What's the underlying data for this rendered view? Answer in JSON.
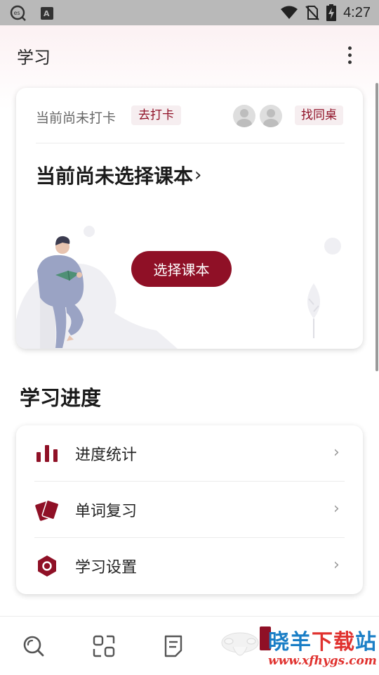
{
  "status_bar": {
    "time": "4:27",
    "left_icons": [
      "es-file-icon",
      "font-app-icon"
    ],
    "right_icons": [
      "wifi-icon",
      "no-sim-icon",
      "battery-charging-icon"
    ]
  },
  "header": {
    "title": "学习",
    "menu_icon": "more-vertical-icon"
  },
  "checkin_card": {
    "status_text": "当前尚未打卡",
    "checkin_button": "去打卡",
    "find_deskmate_button": "找同桌",
    "textbook_title": "当前尚未选择课本",
    "textbook_chevron": "›",
    "select_textbook_button": "选择课本"
  },
  "progress_section": {
    "title": "学习进度",
    "items": [
      {
        "label": "进度统计",
        "icon": "bar-chart-icon",
        "chevron": "›"
      },
      {
        "label": "单词复习",
        "icon": "word-cards-icon",
        "chevron": "›"
      },
      {
        "label": "学习设置",
        "icon": "settings-hexagon-icon",
        "chevron": "›"
      }
    ]
  },
  "tabbar": {
    "tabs": [
      {
        "icon": "search-tab-icon"
      },
      {
        "icon": "scan-tab-icon"
      },
      {
        "icon": "notes-tab-icon"
      },
      {
        "icon": "study-tab-icon"
      }
    ]
  },
  "watermark": {
    "brand_part1": "晓羊",
    "brand_part2": "下载",
    "brand_part3": "站",
    "url": "www.xfhygs.com"
  },
  "colors": {
    "accent": "#8f1026",
    "accent_light_bg": "#f6eef0",
    "status_bar": "#b9b9b9"
  }
}
